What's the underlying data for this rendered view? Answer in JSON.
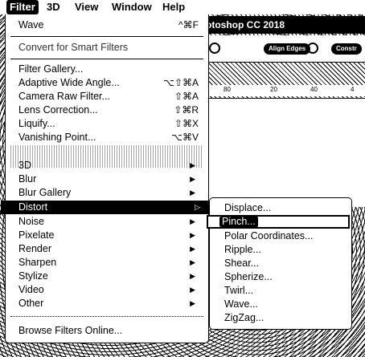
{
  "menubar": {
    "items": [
      "Filter",
      "3D",
      "View",
      "Window",
      "Help"
    ],
    "active": "Filter"
  },
  "app": {
    "title": "otoshop CC 2018",
    "options_pill_1": "Align Edges",
    "options_pill_2": "Constr",
    "ruler_labels": [
      "80",
      "20",
      "40",
      "4"
    ]
  },
  "filter_menu": {
    "last_filter": {
      "label": "Wave",
      "shortcut": "^⌘F"
    },
    "convert": {
      "label": "Convert for Smart Filters"
    },
    "gallery_items": [
      {
        "label": "Filter Gallery...",
        "shortcut": ""
      },
      {
        "label": "Adaptive Wide Angle...",
        "shortcut": "⌥⇧⌘A"
      },
      {
        "label": "Camera Raw Filter...",
        "shortcut": "⇧⌘A"
      },
      {
        "label": "Lens Correction...",
        "shortcut": "⇧⌘R"
      },
      {
        "label": "Liquify...",
        "shortcut": "⇧⌘X"
      },
      {
        "label": "Vanishing Point...",
        "shortcut": "⌥⌘V"
      }
    ],
    "submenus": [
      {
        "label": "3D"
      },
      {
        "label": "Blur"
      },
      {
        "label": "Blur Gallery"
      },
      {
        "label": "Distort"
      },
      {
        "label": "Noise"
      },
      {
        "label": "Pixelate"
      },
      {
        "label": "Render"
      },
      {
        "label": "Sharpen"
      },
      {
        "label": "Stylize"
      },
      {
        "label": "Video"
      },
      {
        "label": "Other"
      }
    ],
    "highlighted_index": 3,
    "browse": {
      "label": "Browse Filters Online..."
    }
  },
  "distort_submenu": {
    "items": [
      "Displace...",
      "Pinch...",
      "Polar Coordinates...",
      "Ripple...",
      "Shear...",
      "Spherize...",
      "Twirl...",
      "Wave...",
      "ZigZag..."
    ],
    "selected_index": 1
  },
  "icons": {
    "submenu_arrow": "triangle-right-icon"
  }
}
